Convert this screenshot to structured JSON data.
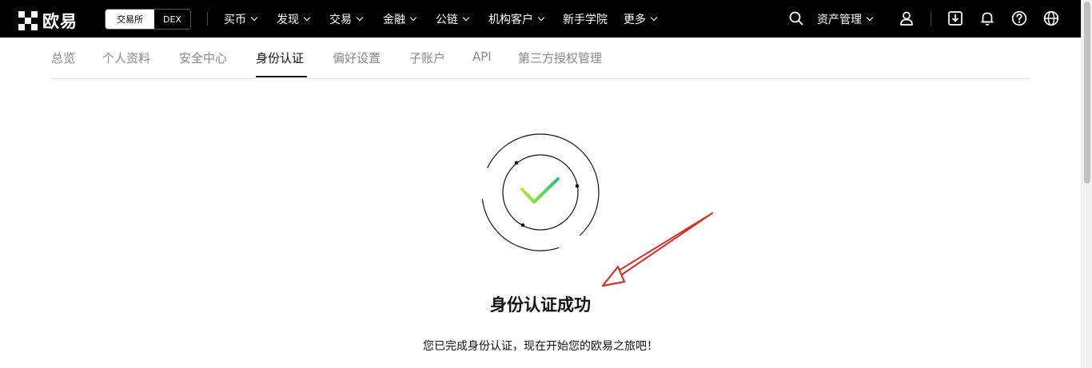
{
  "brand": {
    "name": "欧易"
  },
  "mode_switch": {
    "exchange": "交易所",
    "dex": "DEX"
  },
  "nav": {
    "items": [
      {
        "label": "买币",
        "has_menu": true
      },
      {
        "label": "发现",
        "has_menu": true
      },
      {
        "label": "交易",
        "has_menu": true
      },
      {
        "label": "金融",
        "has_menu": true
      },
      {
        "label": "公链",
        "has_menu": true
      },
      {
        "label": "机构客户",
        "has_menu": true
      },
      {
        "label": "新手学院",
        "has_menu": false
      },
      {
        "label": "更多",
        "has_menu": true
      }
    ],
    "assets_label": "资产管理"
  },
  "subtabs": {
    "items": [
      {
        "label": "总览"
      },
      {
        "label": "个人资料"
      },
      {
        "label": "安全中心"
      },
      {
        "label": "身份认证",
        "active": true
      },
      {
        "label": "偏好设置"
      },
      {
        "label": "子账户"
      },
      {
        "label": "API"
      },
      {
        "label": "第三方授权管理"
      }
    ]
  },
  "success": {
    "title": "身份认证成功",
    "description": "您已完成身份认证，现在开始您的欧易之旅吧！"
  },
  "icons": {
    "search": "search-icon",
    "user": "user-icon",
    "download": "download-icon",
    "bell": "bell-icon",
    "help": "help-icon",
    "globe": "globe-icon",
    "check": "check-icon"
  },
  "colors": {
    "topbar": "#000000",
    "check_start": "#b6e82a",
    "check_end": "#24c970",
    "annotation_arrow": "#d6302a"
  }
}
